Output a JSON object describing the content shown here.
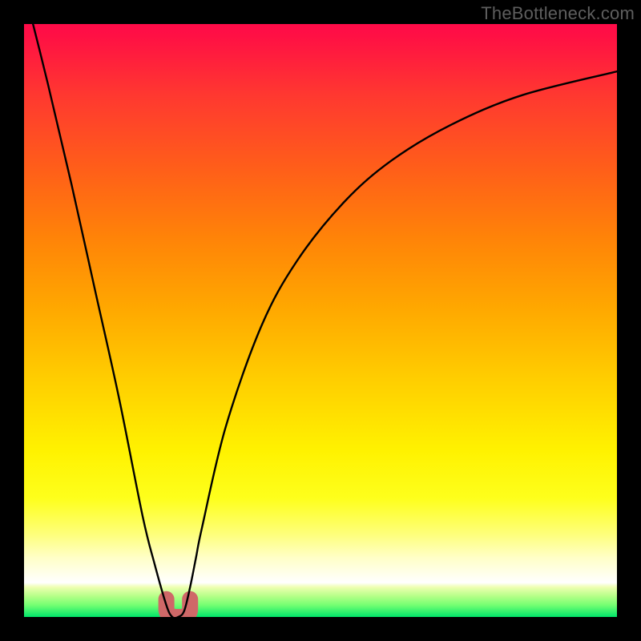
{
  "watermark": "TheBottleneck.com",
  "chart_data": {
    "type": "line",
    "title": "",
    "xlabel": "",
    "ylabel": "",
    "xlim": [
      0,
      100
    ],
    "ylim": [
      0,
      100
    ],
    "grid": false,
    "legend": false,
    "series": [
      {
        "name": "bottleneck-curve",
        "x": [
          0,
          4,
          8,
          12,
          16,
          20,
          22,
          24,
          25,
          26,
          27,
          28,
          29,
          30,
          34,
          40,
          46,
          54,
          62,
          72,
          84,
          100
        ],
        "y": [
          106,
          90,
          73,
          55,
          37,
          17,
          9,
          2,
          0,
          0,
          1,
          5,
          10,
          15,
          32,
          49,
          60,
          70,
          77,
          83,
          88,
          92
        ]
      }
    ],
    "marker": {
      "name": "sweet-spot-marker",
      "x_range": [
        24,
        28
      ],
      "y_min": 0,
      "y_max": 3,
      "color": "#cf6868"
    },
    "background_gradient_stops": [
      {
        "pos": 0.0,
        "color": "#ff0b49"
      },
      {
        "pos": 0.12,
        "color": "#ff3830"
      },
      {
        "pos": 0.24,
        "color": "#ff5d1a"
      },
      {
        "pos": 0.36,
        "color": "#ff8308"
      },
      {
        "pos": 0.48,
        "color": "#ffa800"
      },
      {
        "pos": 0.6,
        "color": "#ffce00"
      },
      {
        "pos": 0.72,
        "color": "#fff200"
      },
      {
        "pos": 0.86,
        "color": "#feff7a"
      },
      {
        "pos": 0.94,
        "color": "#ffffff"
      },
      {
        "pos": 1.0,
        "color": "#00e56a"
      }
    ]
  }
}
